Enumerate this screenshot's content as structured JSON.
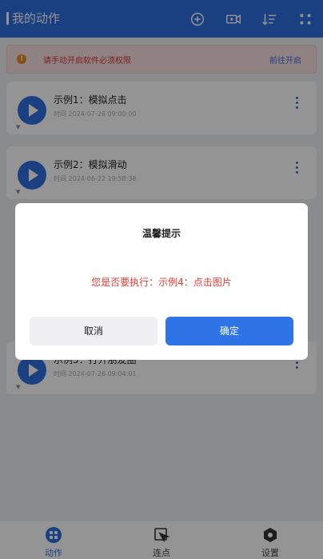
{
  "header": {
    "title": "我的动作",
    "icons": [
      "add-circle-icon",
      "video-record-icon",
      "sort-icon",
      "grid-icon"
    ]
  },
  "notice": {
    "text": "请手动开启软件必须权限",
    "link": "前往开启"
  },
  "actions": [
    {
      "name": "示例1：模拟点击",
      "time": "时间 2024-07-26 09:00:00"
    },
    {
      "name": "示例2：模拟滑动",
      "time": "时间 2024-06-22 19:58:38"
    },
    {
      "name": "示例5：打开朋友圈",
      "time": "时间 2024-07-26 09:04:01"
    }
  ],
  "dialog": {
    "title": "温馨提示",
    "message": "您是否要执行：示例4：点击图片",
    "cancel": "取消",
    "confirm": "确定"
  },
  "tabs": [
    {
      "label": "动作",
      "icon": "apps-icon",
      "active": true
    },
    {
      "label": "连点",
      "icon": "cursor-click-icon",
      "active": false
    },
    {
      "label": "设置",
      "icon": "settings-hex-icon",
      "active": false
    }
  ],
  "colors": {
    "primary": "#2f6fdf",
    "danger": "#e53a32",
    "notice_bg": "#f8dfe0"
  }
}
